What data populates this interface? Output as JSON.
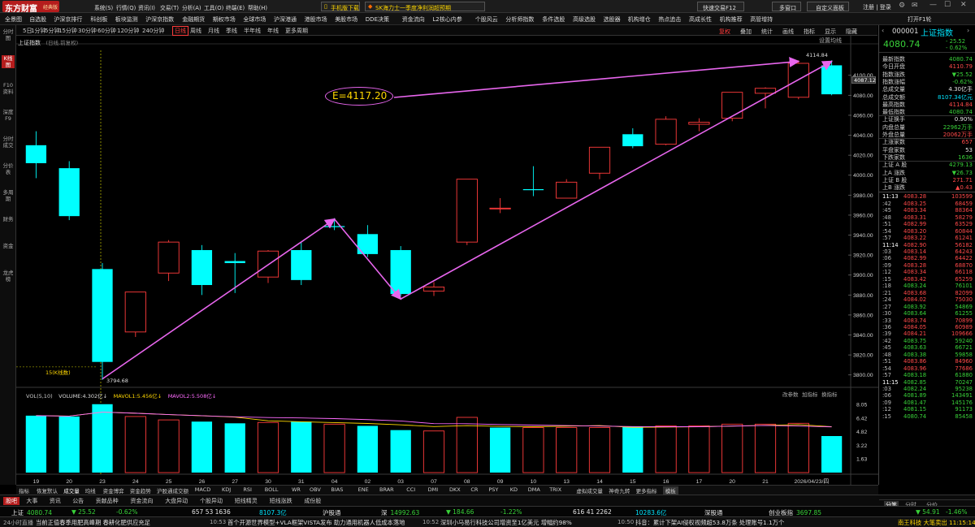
{
  "app": {
    "logo": "东方财富",
    "edition": "经典版",
    "title_menus": [
      "系统(S)",
      "行情(Q)",
      "资讯(I)",
      "交易(T)",
      "分析(A)",
      "工具(O)",
      "终端(E)",
      "帮助(H)"
    ],
    "mobile_download": "手机版下载",
    "news_headline": "SK海力士一季度净利润超预期",
    "quick_trade": "快速交易F12",
    "multi_window": "多窗口",
    "login": "自定义面板",
    "login_register": "注册 | 登录"
  },
  "menubar": [
    "全景图",
    "自选股",
    "沪深京排行",
    "科创板",
    "板块监测",
    "沪深京指数",
    "金融期货",
    "期权市场",
    "全球市场",
    "沪深港通",
    "港股市场",
    "美股市场",
    "DDE决策",
    "资金流向",
    "L2核心内参",
    "个股风云",
    "分析师指数",
    "条件选股",
    "高级选股",
    "选股器",
    "机构增仓",
    "热点追击",
    "高成长性",
    "机构推荐",
    "高管增持",
    "打开F1轮"
  ],
  "periods": [
    "分时",
    "5日",
    "1分钟",
    "5分钟",
    "15分钟",
    "30分钟",
    "60分钟",
    "120分钟",
    "240分钟",
    "日线",
    "周线",
    "月线",
    "季线",
    "半年线",
    "年线",
    "更多周期"
  ],
  "active_period": "日线",
  "chart_toolbar": [
    "复权",
    "叠加",
    "统计",
    "画线",
    "指标",
    "显示",
    "隐藏"
  ],
  "left_tabs": [
    "分时图",
    "K线图",
    "F10资料",
    "深度F9",
    "分时成交",
    "分价表",
    "多周期",
    "财务",
    "资金",
    "龙虎榜"
  ],
  "chart": {
    "index_name": "上证指数",
    "index_sub": "(日线,前复权)",
    "settings": "设置均线",
    "annotation_text": "E=4117.20",
    "high_label": "4114.84",
    "low_label": "3794.68",
    "cross_label": "15(K线数)",
    "current_price_tag": "4087.12",
    "price_axis": [
      "4100.00",
      "4080.00",
      "4060.00",
      "4040.00",
      "4020.00",
      "4000.00",
      "3980.00",
      "3960.00",
      "3940.00",
      "3920.00",
      "3900.00",
      "3880.00",
      "3860.00",
      "3840.00",
      "3820.00",
      "3800.00"
    ],
    "date_labels": [
      "19",
      "20",
      "23",
      "24",
      "25",
      "26",
      "27",
      "30",
      "31",
      "04",
      "02",
      "03",
      "07",
      "08",
      "09",
      "10",
      "13",
      "14",
      "15",
      "16",
      "17",
      "20",
      "21",
      "2026/04/23/四"
    ]
  },
  "chart_data": {
    "type": "candlestick",
    "x": [
      "03-19",
      "03-20",
      "03-23",
      "03-24",
      "03-25",
      "03-26",
      "03-27",
      "03-30",
      "03-31",
      "04-01",
      "04-02",
      "04-03",
      "04-07",
      "04-08",
      "04-09",
      "04-10",
      "04-13",
      "04-14",
      "04-15",
      "04-16",
      "04-17",
      "04-20",
      "04-21",
      "04-22",
      "04-23"
    ],
    "ohlc": [
      [
        4030,
        4044,
        3997,
        4012
      ],
      [
        4007,
        4014,
        3955,
        3959
      ],
      [
        3906,
        3912,
        3795,
        3813
      ],
      [
        3843,
        3882,
        3838,
        3883
      ],
      [
        3902,
        3935,
        3894,
        3933
      ],
      [
        3925,
        3930,
        3880,
        3890
      ],
      [
        3914,
        3922,
        3882,
        3912
      ],
      [
        3898,
        3925,
        3892,
        3924
      ],
      [
        3925,
        3933,
        3890,
        3895
      ],
      [
        3949,
        3957,
        3945,
        3948
      ],
      [
        3941,
        3950,
        3918,
        3921
      ],
      [
        3925,
        3929,
        3879,
        3881
      ],
      [
        3884,
        3893,
        3879,
        3888
      ],
      [
        3933,
        3996,
        3930,
        3996
      ],
      [
        3967,
        3977,
        3962,
        3967
      ],
      [
        3986,
        4009,
        3979,
        3985
      ],
      [
        3977,
        3996,
        3977,
        3993
      ],
      [
        4002,
        4025,
        3996,
        4028
      ],
      [
        4041,
        4047,
        4027,
        4029
      ],
      [
        4031,
        4059,
        4030,
        4056
      ],
      [
        4051,
        4057,
        4044,
        4053
      ],
      [
        4057,
        4083,
        4054,
        4083
      ],
      [
        4082,
        4088,
        4067,
        4087
      ],
      [
        4078,
        4115,
        4076,
        4112
      ],
      [
        4110,
        4115,
        4080,
        4081
      ]
    ],
    "volume_label": "VOL(5,10)",
    "volume_current": "VOLUME:4.302亿↓",
    "mavol1": "MAVOL1:5.456亿↓",
    "mavol2": "MAVOL2:5.508亿↓",
    "volume_axis": [
      "8.05",
      "6.42",
      "4.82",
      "3.22",
      "1.63"
    ],
    "volumes": [
      6.7,
      6.6,
      8.05,
      6.6,
      6.2,
      6.0,
      5.8,
      5.9,
      6.0,
      5.7,
      5.5,
      5.0,
      4.9,
      6.5,
      5.3,
      5.3,
      5.3,
      5.3,
      5.4,
      5.5,
      5.5,
      5.7,
      5.7,
      5.8,
      4.3
    ],
    "down_days": [
      0,
      1,
      2,
      5,
      6,
      8,
      10,
      11,
      14,
      18,
      24
    ],
    "ylim": [
      3790,
      4125
    ],
    "vol_ylim": [
      0,
      8.6
    ],
    "annotations": [
      {
        "kind": "arrow",
        "from": [
          "03-23",
          3796
        ],
        "to": [
          "04-01",
          3956
        ]
      },
      {
        "kind": "arrow",
        "from": [
          "04-01",
          3956
        ],
        "to": [
          "04-03",
          3876
        ]
      },
      {
        "kind": "arrow",
        "from": [
          "04-03",
          3876
        ],
        "to": [
          "04-23",
          4114
        ]
      },
      {
        "kind": "arrow",
        "from": "E=4117.20",
        "to": [
          "04-22",
          4114
        ]
      }
    ]
  },
  "volume_tools": [
    "改参数",
    "加指标",
    "换指标"
  ],
  "indicator_tabs": [
    "指标",
    "恢复默认",
    "成交量",
    "均线",
    "资金博弈",
    "资金趋势",
    "沪股通成交额",
    "MACD",
    "KDJ",
    "RSI",
    "BOLL",
    "WR",
    "OBV",
    "BIAS",
    "ENE",
    "BRAR",
    "CCI",
    "DMI",
    "DKX",
    "CR",
    "PSY",
    "KD",
    "DMA",
    "TRIX",
    "虚拟成交量",
    "神奇九转",
    "更多指标",
    "模板"
  ],
  "bottom_tabs": [
    "股吧",
    "大事",
    "资讯",
    "公告",
    "贡献品种",
    "资金流向",
    "大盘异动",
    "个股异动",
    "短线精灵",
    "短线涨跌",
    "成份股"
  ],
  "quote": {
    "code": "000001",
    "name": "上证指数",
    "price": "4080.74",
    "change": "- 25.52",
    "change_pct": "- 0.62%",
    "rows": [
      {
        "k": "最新指数",
        "v": "4080.74",
        "c": "green"
      },
      {
        "k": "今日开盘",
        "v": "4110.79",
        "c": "red"
      },
      {
        "k": "指数涨跌",
        "v": "▼25.52",
        "c": "green"
      },
      {
        "k": "指数涨幅",
        "v": "-0.62%",
        "c": "green"
      },
      {
        "k": "总成交量",
        "v": "4.30亿手",
        "c": "white"
      },
      {
        "k": "总成交额",
        "v": "8107.34亿元",
        "c": "cyan"
      },
      {
        "k": "最高指数",
        "v": "4114.84",
        "c": "red"
      },
      {
        "k": "最低指数",
        "v": "4080.74",
        "c": "green"
      },
      {
        "k": "上证换手",
        "v": "0.90%",
        "c": "white"
      },
      {
        "k": "内盘总量",
        "v": "22962万手",
        "c": "green"
      },
      {
        "k": "外盘总量",
        "v": "20062万手",
        "c": "red"
      },
      {
        "k": "上涨家数",
        "v": "657",
        "c": "red"
      },
      {
        "k": "平盘家数",
        "v": "53",
        "c": "white"
      },
      {
        "k": "下跌家数",
        "v": "1636",
        "c": "green"
      },
      {
        "k": "上证 A 股",
        "v": "4279.13",
        "c": "green"
      },
      {
        "k": "上A 涨跌",
        "v": "▼26.73",
        "c": "green"
      },
      {
        "k": "上证 B 股",
        "v": "271.71",
        "c": "red"
      },
      {
        "k": "上B 涨跌",
        "v": "▲0.43",
        "c": "red"
      }
    ],
    "ticks": [
      {
        "t": "11:13",
        "p": "4083.28",
        "v": "103599",
        "c": "red",
        "head": true
      },
      {
        "t": ":42",
        "p": "4083.25",
        "v": "68459",
        "c": "red"
      },
      {
        "t": ":45",
        "p": "4083.34",
        "v": "88364",
        "c": "red"
      },
      {
        "t": ":48",
        "p": "4083.31",
        "v": "58279",
        "c": "red"
      },
      {
        "t": ":51",
        "p": "4082.99",
        "v": "63529",
        "c": "red"
      },
      {
        "t": ":54",
        "p": "4083.20",
        "v": "60844",
        "c": "red"
      },
      {
        "t": ":57",
        "p": "4083.22",
        "v": "61241",
        "c": "red"
      },
      {
        "t": "11:14",
        "p": "4082.90",
        "v": "56182",
        "c": "red",
        "head": true
      },
      {
        "t": ":03",
        "p": "4083.14",
        "v": "64243",
        "c": "red"
      },
      {
        "t": ":06",
        "p": "4082.99",
        "v": "64422",
        "c": "red"
      },
      {
        "t": ":09",
        "p": "4083.28",
        "v": "68870",
        "c": "red"
      },
      {
        "t": ":12",
        "p": "4083.34",
        "v": "66118",
        "c": "red"
      },
      {
        "t": ":15",
        "p": "4083.42",
        "v": "65259",
        "c": "red"
      },
      {
        "t": ":18",
        "p": "4083.24",
        "v": "76101",
        "c": "green"
      },
      {
        "t": ":21",
        "p": "4083.68",
        "v": "82099",
        "c": "red"
      },
      {
        "t": ":24",
        "p": "4084.02",
        "v": "75030",
        "c": "red"
      },
      {
        "t": ":27",
        "p": "4083.92",
        "v": "54869",
        "c": "green"
      },
      {
        "t": ":30",
        "p": "4083.64",
        "v": "61255",
        "c": "green"
      },
      {
        "t": ":33",
        "p": "4083.74",
        "v": "70899",
        "c": "red"
      },
      {
        "t": ":36",
        "p": "4084.05",
        "v": "60989",
        "c": "red"
      },
      {
        "t": ":39",
        "p": "4084.21",
        "v": "109666",
        "c": "red"
      },
      {
        "t": ":42",
        "p": "4083.75",
        "v": "59240",
        "c": "green"
      },
      {
        "t": ":45",
        "p": "4083.63",
        "v": "66721",
        "c": "green"
      },
      {
        "t": ":48",
        "p": "4083.38",
        "v": "59858",
        "c": "green"
      },
      {
        "t": ":51",
        "p": "4083.86",
        "v": "84960",
        "c": "red"
      },
      {
        "t": ":54",
        "p": "4083.96",
        "v": "77686",
        "c": "red"
      },
      {
        "t": ":57",
        "p": "4083.18",
        "v": "61880",
        "c": "green"
      },
      {
        "t": "11:15",
        "p": "4082.85",
        "v": "70247",
        "c": "green",
        "head": true
      },
      {
        "t": ":03",
        "p": "4082.24",
        "v": "95238",
        "c": "green"
      },
      {
        "t": ":06",
        "p": "4081.89",
        "v": "143491",
        "c": "green"
      },
      {
        "t": ":09",
        "p": "4081.47",
        "v": "145176",
        "c": "green"
      },
      {
        "t": ":12",
        "p": "4081.15",
        "v": "91173",
        "c": "green"
      },
      {
        "t": ":15",
        "p": "4080.74",
        "v": "85458",
        "c": "green"
      }
    ],
    "panel_tabs": [
      "分笔",
      "分时",
      "分价"
    ]
  },
  "status": [
    {
      "k": "上证",
      "v": "4080.74",
      "c": "green"
    },
    {
      "k": "",
      "v": "▼ 25.52",
      "c": "green"
    },
    {
      "k": "",
      "v": "-0.62%",
      "c": "green"
    },
    {
      "k": "",
      "v": "657 53 1636",
      "c": "white"
    },
    {
      "k": "",
      "v": "8107.3亿",
      "c": "cyan"
    },
    {
      "k": "沪股通",
      "v": "",
      "c": "white"
    },
    {
      "k": "深",
      "v": "14992.63",
      "c": "green"
    },
    {
      "k": "",
      "v": "▼ 184.66",
      "c": "green"
    },
    {
      "k": "",
      "v": "-1.22%",
      "c": "green"
    },
    {
      "k": "",
      "v": "616 41 2262",
      "c": "white"
    },
    {
      "k": "",
      "v": "10283.6亿",
      "c": "cyan"
    },
    {
      "k": "深股通",
      "v": "",
      "c": "white"
    },
    {
      "k": "创业板指",
      "v": "3697.85",
      "c": "green"
    },
    {
      "k": "",
      "v": "▼ 54.91",
      "c": "green"
    },
    {
      "k": "",
      "v": "-1.46%",
      "c": "green"
    }
  ],
  "news": [
    {
      "src": "24小时直播",
      "text": "当前正值春季用肥高峰期 春耕化肥供应充足"
    },
    {
      "src": "10:53",
      "text": "首个开源世界模型+VLA框架VISTA发布 助力通用机器人低成本落地"
    },
    {
      "src": "10:52",
      "text": "深圳小马易行科技公司增资至1亿美元 增幅约98%"
    },
    {
      "src": "10:50",
      "text": "抖音：累计下架AI侵权视频超53.8万条 处理账号1.1万个"
    },
    {
      "src": "",
      "text": "南王科技  大笔卖出 11:15:14"
    }
  ]
}
